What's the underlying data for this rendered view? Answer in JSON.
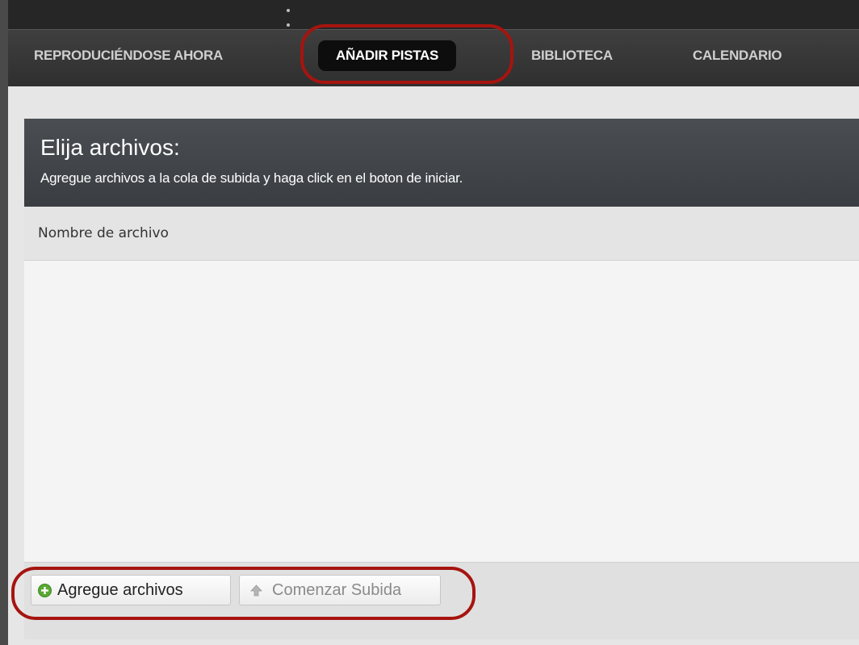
{
  "nav": {
    "items": [
      {
        "label": "REPRODUCIÉNDOSE AHORA"
      },
      {
        "label": "AÑADIR PISTAS"
      },
      {
        "label": "BIBLIOTECA"
      },
      {
        "label": "CALENDARIO"
      }
    ],
    "active_index": 1
  },
  "panel": {
    "title": "Elija archivos:",
    "subtitle": "Agregue archivos a la cola de subida y haga click en el boton de iniciar.",
    "column_header": "Nombre de archivo",
    "files": []
  },
  "buttons": {
    "add_files": {
      "label": "Agregue archivos",
      "icon": "plus-circle-icon",
      "icon_color": "#5aa832"
    },
    "start_upload": {
      "label": "Comenzar Subida",
      "icon": "arrow-up-icon",
      "disabled": true
    }
  },
  "colors": {
    "highlight": "#a6140f",
    "nav_background": "#333333",
    "active_tab": "#0d0d0d",
    "header_background": "#43474b"
  }
}
